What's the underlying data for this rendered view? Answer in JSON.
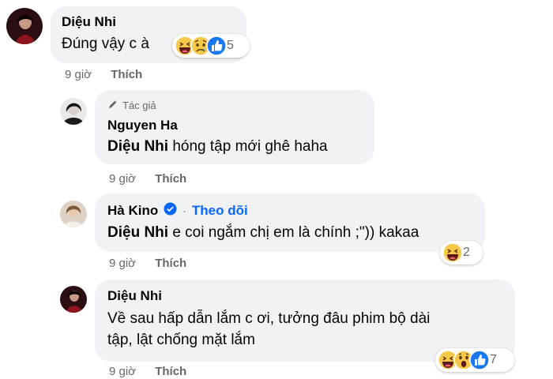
{
  "comments": [
    {
      "author": "Diệu Nhi",
      "text": "Đúng vậy c à",
      "time": "9 giờ",
      "like_label": "Thích",
      "reaction_count": "5"
    },
    {
      "badge": "Tác giả",
      "author": "Nguyen Ha",
      "mention": "Diệu Nhi",
      "text": " hóng tập mới ghê haha",
      "time": "9 giờ",
      "like_label": "Thích"
    },
    {
      "author": "Hà Kino",
      "follow_label": "Theo dõi",
      "mention": "Diệu Nhi",
      "text": " e coi ngắm chị em là chính ;\")) kakaa",
      "time": "9 giờ",
      "like_label": "Thích",
      "reaction_count": "2"
    },
    {
      "author": "Diệu Nhi",
      "text_line1": "Về sau hấp dẫn lắm c ơi, tưởng đâu phim bộ dài",
      "text_line2": "tập, lật chống mặt lắm",
      "time": "9 giờ",
      "like_label": "Thích",
      "reaction_count": "7"
    }
  ],
  "colors": {
    "bubble": "#f0f2f5",
    "meta": "#65676b",
    "link": "#0866ff",
    "like_reaction": "#1877f2",
    "emoji": "#f7c94b"
  },
  "icons": [
    "pencil-icon",
    "verified-icon",
    "haha-reaction-icon",
    "sad-reaction-icon",
    "like-reaction-icon",
    "wow-reaction-icon"
  ]
}
